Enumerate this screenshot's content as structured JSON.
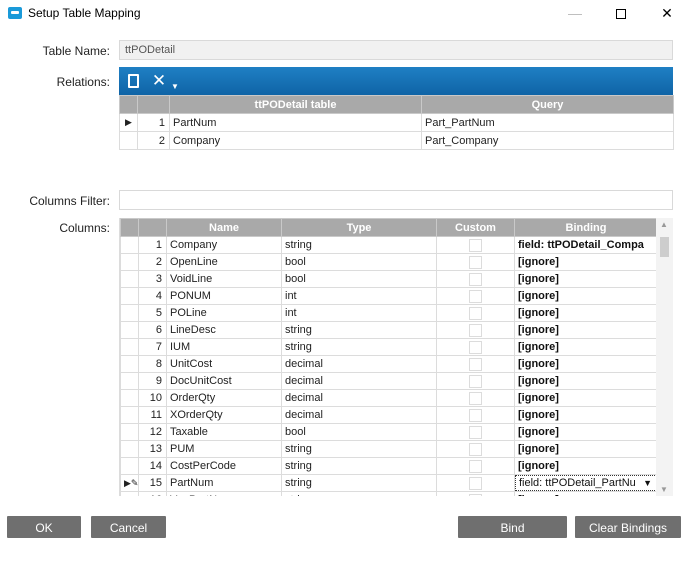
{
  "window": {
    "title": "Setup Table Mapping",
    "controls": {
      "minimize": "—",
      "maximize": "☐",
      "close": "✕"
    }
  },
  "form": {
    "table_name_label": "Table Name:",
    "table_name_value": "ttPODetail",
    "relations_label": "Relations:",
    "columns_filter_label": "Columns Filter:",
    "columns_filter_value": "",
    "columns_label": "Columns:"
  },
  "relations": {
    "toolbar": {
      "new_icon": "new-document-icon",
      "delete_icon": "delete-x-icon",
      "dropdown_icon": "caret-down-icon"
    },
    "headers": [
      "ttPODetail table",
      "Query"
    ],
    "rows": [
      {
        "selector": "▶",
        "n": "1",
        "table_field": "PartNum",
        "query_field": "Part_PartNum"
      },
      {
        "selector": "",
        "n": "2",
        "table_field": "Company",
        "query_field": "Part_Company"
      }
    ]
  },
  "columns": {
    "headers": [
      "Name",
      "Type",
      "Custom",
      "Binding"
    ],
    "rows": [
      {
        "selector": "",
        "n": "1",
        "name": "Company",
        "type": "string",
        "binding": "field: ttPODetail_Compa"
      },
      {
        "selector": "",
        "n": "2",
        "name": "OpenLine",
        "type": "bool",
        "binding": "[ignore]"
      },
      {
        "selector": "",
        "n": "3",
        "name": "VoidLine",
        "type": "bool",
        "binding": "[ignore]"
      },
      {
        "selector": "",
        "n": "4",
        "name": "PONUM",
        "type": "int",
        "binding": "[ignore]"
      },
      {
        "selector": "",
        "n": "5",
        "name": "POLine",
        "type": "int",
        "binding": "[ignore]"
      },
      {
        "selector": "",
        "n": "6",
        "name": "LineDesc",
        "type": "string",
        "binding": "[ignore]"
      },
      {
        "selector": "",
        "n": "7",
        "name": "IUM",
        "type": "string",
        "binding": "[ignore]"
      },
      {
        "selector": "",
        "n": "8",
        "name": "UnitCost",
        "type": "decimal",
        "binding": "[ignore]"
      },
      {
        "selector": "",
        "n": "9",
        "name": "DocUnitCost",
        "type": "decimal",
        "binding": "[ignore]"
      },
      {
        "selector": "",
        "n": "10",
        "name": "OrderQty",
        "type": "decimal",
        "binding": "[ignore]"
      },
      {
        "selector": "",
        "n": "11",
        "name": "XOrderQty",
        "type": "decimal",
        "binding": "[ignore]"
      },
      {
        "selector": "",
        "n": "12",
        "name": "Taxable",
        "type": "bool",
        "binding": "[ignore]"
      },
      {
        "selector": "",
        "n": "13",
        "name": "PUM",
        "type": "string",
        "binding": "[ignore]"
      },
      {
        "selector": "",
        "n": "14",
        "name": "CostPerCode",
        "type": "string",
        "binding": "[ignore]"
      },
      {
        "selector": "▶✎",
        "n": "15",
        "name": "PartNum",
        "type": "string",
        "binding": "field: ttPODetail_PartNu",
        "active": true
      },
      {
        "selector": "",
        "n": "16",
        "name": "VenPartNum",
        "type": "string",
        "binding": "[ignore]"
      }
    ]
  },
  "buttons": {
    "ok": "OK",
    "cancel": "Cancel",
    "bind_automatically": "Bind Automatically",
    "clear_bindings": "Clear Bindings"
  },
  "colors": {
    "toolbar_blue": "#1773b8",
    "header_gray": "#a9a9a9",
    "button_gray": "#6f6f6f"
  }
}
